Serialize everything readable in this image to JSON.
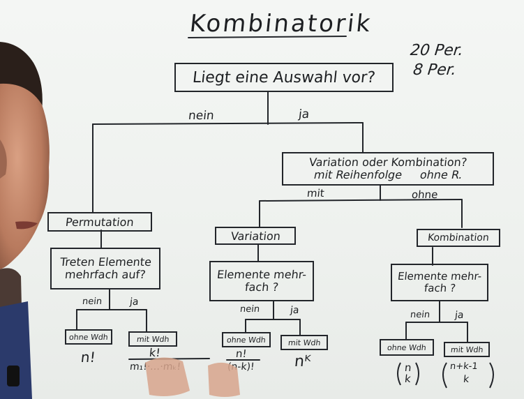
{
  "title": "Kombinatorik",
  "side_notes": [
    "20 Per.",
    "8 Per."
  ],
  "root_question": "Liegt eine Auswahl vor?",
  "branch_no": "nein",
  "branch_yes": "ja",
  "var_or_comb": {
    "line1": "Variation oder Kombination?",
    "line2_left": "mit Reihenfolge",
    "line2_right": "ohne R."
  },
  "branch_with": "mit",
  "branch_without": "ohne",
  "permutation": {
    "label": "Permutation",
    "question_line1": "Treten Elemente",
    "question_line2": "mehrfach auf?",
    "no": "nein",
    "yes": "ja",
    "without_rep": "ohne Wdh",
    "with_rep": "mit Wdh",
    "formula_without": "n!",
    "formula_with_num": "k!",
    "formula_with_den": "m₁!·…·mₖ!"
  },
  "variation": {
    "label": "Variation",
    "question_line1": "Elemente mehr-",
    "question_line2": "fach ?",
    "no": "nein",
    "yes": "ja",
    "without_rep": "ohne Wdh",
    "with_rep": "mit Wdh",
    "formula_without_num": "n!",
    "formula_without_den": "(n-k)!",
    "formula_with": "nᴷ"
  },
  "kombination": {
    "label": "Kombination",
    "question_line1": "Elemente mehr-",
    "question_line2": "fach ?",
    "no": "nein",
    "yes": "ja",
    "without_rep": "ohne Wdh",
    "with_rep": "mit Wdh",
    "formula_without_top": "n",
    "formula_without_bottom": "k",
    "formula_with_top": "n+k-1",
    "formula_with_bottom": "k"
  }
}
